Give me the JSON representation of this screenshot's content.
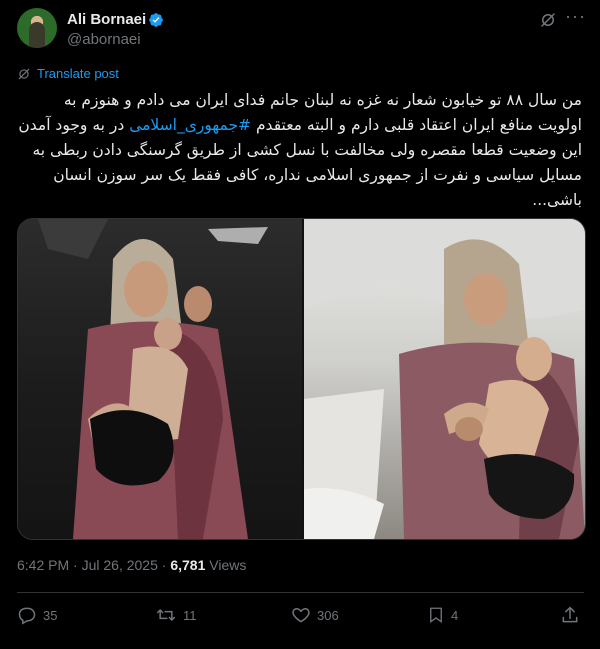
{
  "author": {
    "name": "Ali Bornaei",
    "handle": "@abornaei",
    "verified": true,
    "avatar_icon": "profile-photo"
  },
  "translate_label": "Translate post",
  "tweet": {
    "text_before_hashtag": "من سال ۸۸ تو خیابون شعار نه غزه نه لبنان جانم فدای ایران می دادم و هنوزم به اولویت منافع ایران اعتقاد قلبی دارم و البته معتقدم ",
    "hashtag": "#جمهوری_اسلامی",
    "text_after_hashtag": " در به وجود آمدن این وضعیت قطعا مقصره ولی مخالفت با نسل کشی از طریق گرسنگی دادن ربطی به مسایل سیاسی و نفرت از جمهوری اسلامی نداره، کافی فقط یک سر سوزن انسان باشی..."
  },
  "meta": {
    "time": "6:42 PM",
    "separator": "·",
    "date": "Jul 26, 2025",
    "views_count": "6,781",
    "views_label": "Views"
  },
  "actions": {
    "replies": "35",
    "reposts": "11",
    "likes": "306",
    "bookmarks": "4"
  },
  "colors": {
    "background": "#000000",
    "text": "#e7e9ea",
    "muted": "#71767b",
    "accent": "#1d9bf0",
    "border": "#2f3336"
  }
}
